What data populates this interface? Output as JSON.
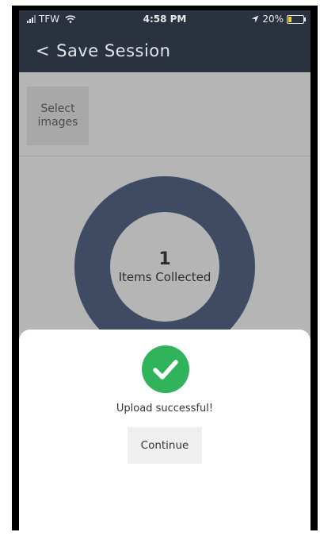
{
  "status_bar": {
    "carrier": "TFW",
    "time": "4:58 PM",
    "battery": "20%",
    "battery_level": 0.2,
    "icons": [
      "signal-icon",
      "wifi-icon",
      "location-arrow-icon",
      "battery-icon"
    ]
  },
  "header": {
    "back_label": "<",
    "title": "Save Session"
  },
  "select_images": {
    "label": "Select images"
  },
  "summary": {
    "count": "1",
    "label": "Items Collected"
  },
  "modal": {
    "icon": "check-circle-icon",
    "message": "Upload successful!",
    "continue_label": "Continue"
  },
  "colors": {
    "header_bg": "#2b323f",
    "overlay_bg": "#b5b5b5",
    "donut": "#3e4b63",
    "success": "#30b35a",
    "battery_fill": "#f2d11b"
  }
}
